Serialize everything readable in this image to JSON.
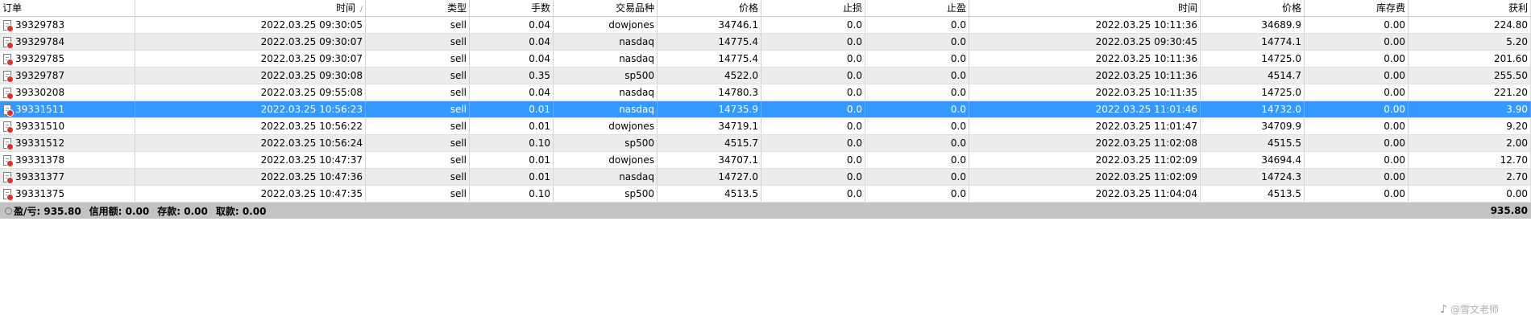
{
  "columns": [
    "订单",
    "时间",
    "类型",
    "手数",
    "交易品种",
    "价格",
    "止损",
    "止盈",
    "时间",
    "价格",
    "库存费",
    "获利"
  ],
  "sort_indicator": "/",
  "rows": [
    [
      "39329783",
      "2022.03.25 09:30:05",
      "sell",
      "0.04",
      "dowjones",
      "34746.1",
      "0.0",
      "0.0",
      "2022.03.25 10:11:36",
      "34689.9",
      "0.00",
      "224.80"
    ],
    [
      "39329784",
      "2022.03.25 09:30:07",
      "sell",
      "0.04",
      "nasdaq",
      "14775.4",
      "0.0",
      "0.0",
      "2022.03.25 09:30:45",
      "14774.1",
      "0.00",
      "5.20"
    ],
    [
      "39329785",
      "2022.03.25 09:30:07",
      "sell",
      "0.04",
      "nasdaq",
      "14775.4",
      "0.0",
      "0.0",
      "2022.03.25 10:11:36",
      "14725.0",
      "0.00",
      "201.60"
    ],
    [
      "39329787",
      "2022.03.25 09:30:08",
      "sell",
      "0.35",
      "sp500",
      "4522.0",
      "0.0",
      "0.0",
      "2022.03.25 10:11:36",
      "4514.7",
      "0.00",
      "255.50"
    ],
    [
      "39330208",
      "2022.03.25 09:55:08",
      "sell",
      "0.04",
      "nasdaq",
      "14780.3",
      "0.0",
      "0.0",
      "2022.03.25 10:11:35",
      "14725.0",
      "0.00",
      "221.20"
    ],
    [
      "39331511",
      "2022.03.25 10:56:23",
      "sell",
      "0.01",
      "nasdaq",
      "14735.9",
      "0.0",
      "0.0",
      "2022.03.25 11:01:46",
      "14732.0",
      "0.00",
      "3.90"
    ],
    [
      "39331510",
      "2022.03.25 10:56:22",
      "sell",
      "0.01",
      "dowjones",
      "34719.1",
      "0.0",
      "0.0",
      "2022.03.25 11:01:47",
      "34709.9",
      "0.00",
      "9.20"
    ],
    [
      "39331512",
      "2022.03.25 10:56:24",
      "sell",
      "0.10",
      "sp500",
      "4515.7",
      "0.0",
      "0.0",
      "2022.03.25 11:02:08",
      "4515.5",
      "0.00",
      "2.00"
    ],
    [
      "39331378",
      "2022.03.25 10:47:37",
      "sell",
      "0.01",
      "dowjones",
      "34707.1",
      "0.0",
      "0.0",
      "2022.03.25 11:02:09",
      "34694.4",
      "0.00",
      "12.70"
    ],
    [
      "39331377",
      "2022.03.25 10:47:36",
      "sell",
      "0.01",
      "nasdaq",
      "14727.0",
      "0.0",
      "0.0",
      "2022.03.25 11:02:09",
      "14724.3",
      "0.00",
      "2.70"
    ],
    [
      "39331375",
      "2022.03.25 10:47:35",
      "sell",
      "0.10",
      "sp500",
      "4513.5",
      "0.0",
      "0.0",
      "2022.03.25 11:04:04",
      "4513.5",
      "0.00",
      "0.00"
    ]
  ],
  "selected_row": 5,
  "summary": {
    "pnl": "盈/亏: 935.80",
    "credit": "信用额: 0.00",
    "deposit": "存款: 0.00",
    "withdraw": "取款: 0.00",
    "total": "935.80"
  },
  "watermark": "@雪文老师",
  "colors": {
    "selection": "#3399ff",
    "alt_row": "#ececec",
    "summary_bg": "#c3c3c3",
    "order_icon_badge": "#e0302b"
  }
}
